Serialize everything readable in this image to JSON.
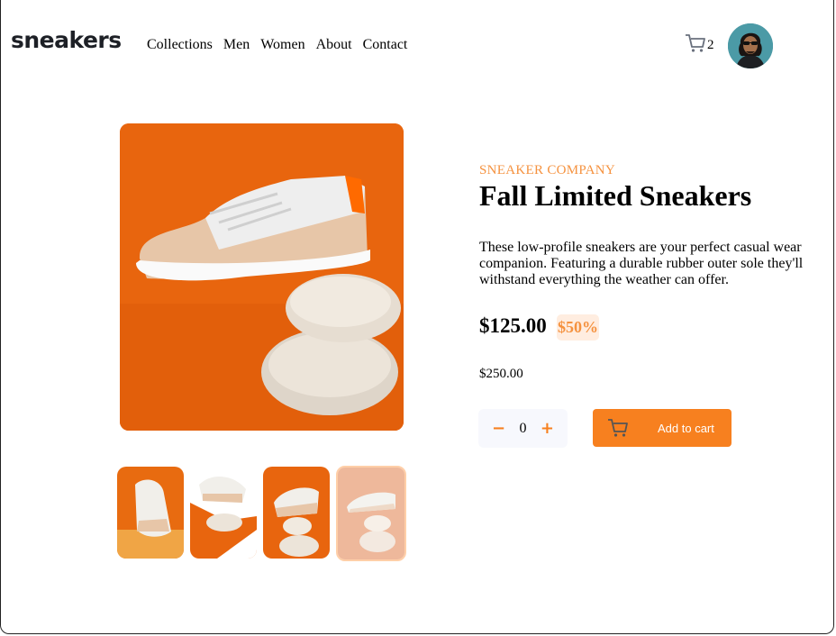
{
  "header": {
    "logo": "sneakers",
    "nav": [
      "Collections",
      "Men",
      "Women",
      "About",
      "Contact"
    ],
    "cart_count": "2"
  },
  "product": {
    "company": "SNEAKER COMPANY",
    "title": "Fall Limited Sneakers",
    "description": "These low-profile sneakers are your perfect casual wear companion. Featuring a durable rubber outer sole they'll withstand everything the weather can offer.",
    "price": "$125.00",
    "discount": "$50%",
    "old_price": "$250.00",
    "quantity": "0",
    "add_to_cart_label": "Add to cart"
  },
  "colors": {
    "accent": "#f7801f",
    "accent_text": "#f5923f",
    "accent_pale": "#ffede0",
    "photo_bg": "#e8650e"
  },
  "icons": {
    "cart": "cart-icon",
    "minus": "minus-icon",
    "plus": "plus-icon",
    "add_cart": "cart-icon"
  }
}
